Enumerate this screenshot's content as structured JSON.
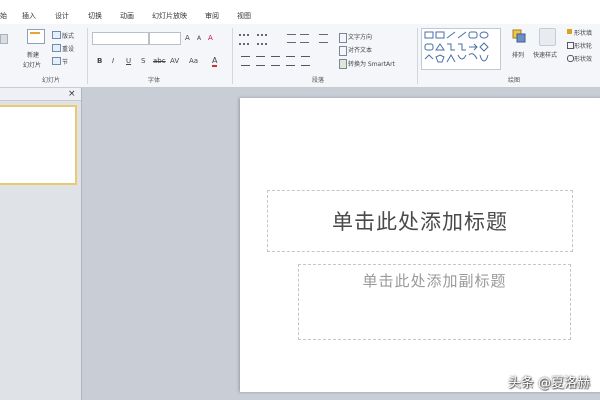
{
  "ribbon_tabs": [
    "始",
    "插入",
    "设计",
    "切换",
    "动画",
    "幻灯片放映",
    "审阅",
    "视图"
  ],
  "slides_group": {
    "new_slide": "新建",
    "new_slide_sub": "幻灯片",
    "layout": "版式",
    "reset": "重设",
    "section": "节",
    "label": "幻灯片"
  },
  "font_group": {
    "font_name": "",
    "font_size": "",
    "grow": "A",
    "shrink": "A",
    "clear": "A",
    "bold": "B",
    "italic": "I",
    "underline": "U",
    "strike": "S",
    "shadow": "abc",
    "spacing": "AV",
    "case": "Aa",
    "color": "A",
    "label": "字体"
  },
  "paragraph_group": {
    "text_direction": "文字方向",
    "align_text": "对齐文本",
    "smartart": "转换为 SmartArt",
    "label": "段落"
  },
  "drawing_group": {
    "arrange": "排列",
    "quick_styles": "快速样式",
    "shape_fill": "形状填",
    "shape_outline": "形状轮",
    "shape_effects": "形状效",
    "label": "绘图"
  },
  "pane": {
    "close": "×"
  },
  "slide": {
    "title_placeholder": "单击此处添加标题",
    "subtitle_placeholder": "单击此处添加副标题"
  },
  "watermark": "头条 @夏洛赫"
}
